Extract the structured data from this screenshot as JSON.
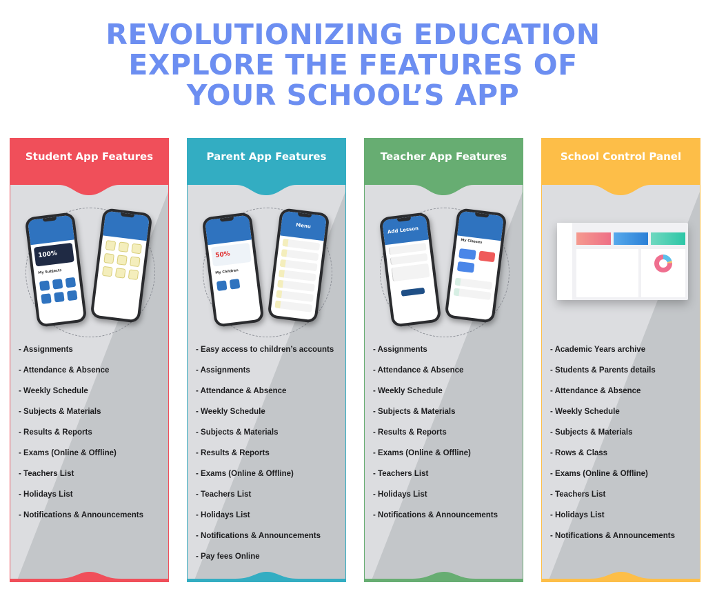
{
  "headline": [
    "REVOLUTIONIZING EDUCATION",
    "EXPLORE THE FEATURES OF",
    "YOUR SCHOOL’S APP"
  ],
  "colors": {
    "headline": "#6c8ef1",
    "student": "#f04f5a",
    "parent": "#33adc2",
    "teacher": "#67ad72",
    "school": "#fdbe48"
  },
  "cards": [
    {
      "title": "Student App Features",
      "screen_a": {
        "banner": "100%",
        "section": "My Subjects"
      },
      "features": [
        "- Assignments",
        "- Attendance & Absence",
        "- Weekly Schedule",
        "- Subjects & Materials",
        "- Results & Reports",
        "- Exams (Online & Offline)",
        "- Teachers List",
        "- Holidays List",
        "- Notifications & Announcements"
      ]
    },
    {
      "title": "Parent App Features",
      "screen_a": {
        "banner": "50%",
        "section": "My Children"
      },
      "screen_b": {
        "header": "Menu"
      },
      "features": [
        "- Easy access to children’s accounts",
        "- Assignments",
        "- Attendance & Absence",
        "- Weekly Schedule",
        "- Subjects & Materials",
        "- Results & Reports",
        "- Exams (Online & Offline)",
        "- Teachers List",
        "- Holidays List",
        "- Notifications & Announcements",
        "- Pay fees Online"
      ]
    },
    {
      "title": "Teacher App Features",
      "screen_a": {
        "header": "Add Lesson"
      },
      "screen_b": {
        "section": "My Classes"
      },
      "features": [
        "- Assignments",
        "- Attendance & Absence",
        "- Weekly Schedule",
        "- Subjects & Materials",
        "- Results & Reports",
        "- Exams (Online & Offline)",
        "- Teachers List",
        "- Holidays List",
        "- Notifications & Announcements"
      ]
    },
    {
      "title": "School Control Panel",
      "features": [
        "- Academic Years archive",
        "- Students & Parents details",
        "- Attendance & Absence",
        "- Weekly Schedule",
        "- Subjects & Materials",
        "- Rows & Class",
        "- Exams (Online & Offline)",
        "- Teachers List",
        "- Holidays List",
        "- Notifications & Announcements"
      ]
    }
  ]
}
